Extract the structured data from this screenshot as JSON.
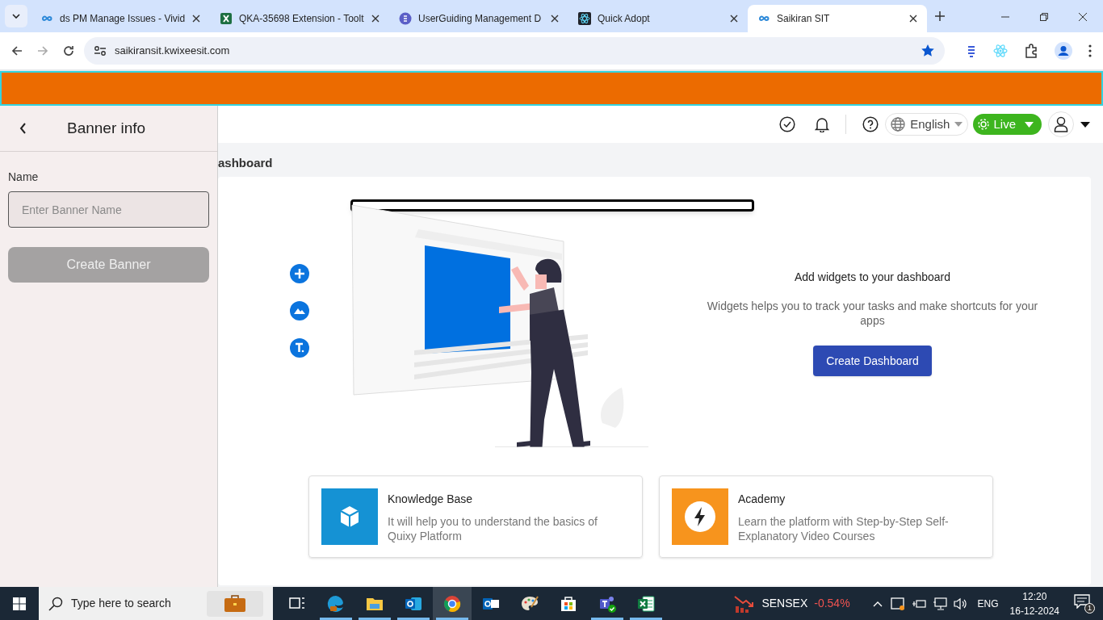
{
  "browser": {
    "tabs": [
      {
        "title": "ds PM Manage Issues - Vivid",
        "kind": "loop",
        "selected": false
      },
      {
        "title": "QKA-35698 Extension - Toolt",
        "kind": "excel",
        "selected": false
      },
      {
        "title": "UserGuiding Management D",
        "kind": "guide",
        "selected": false
      },
      {
        "title": "Quick Adopt",
        "kind": "atom",
        "selected": false
      },
      {
        "title": "Saikiran SIT",
        "kind": "loop",
        "selected": true
      }
    ],
    "url": "saikiransit.kwixeesit.com",
    "bookmarked": true
  },
  "panel": {
    "title": "Banner info",
    "name_label": "Name",
    "name_placeholder": "Enter Banner Name",
    "create_button": "Create Banner",
    "create_disabled": true
  },
  "header": {
    "language": "English",
    "mode": "Live"
  },
  "page_title": "ashboard",
  "dashboard": {
    "heading": "Add widgets to your dashboard",
    "description": "Widgets helps you to track your tasks and make shortcuts for your apps",
    "button": "Create Dashboard",
    "cards": [
      {
        "kind": "knowledge",
        "title": "Knowledge Base",
        "text": "It will help you to understand the basics of Quixy Platform",
        "color": "#1592d4"
      },
      {
        "kind": "academy",
        "title": "Academy",
        "text": "Learn the platform with Step-by-Step Self-Explanatory Video Courses",
        "color": "#f7941d"
      }
    ]
  },
  "taskbar": {
    "search_placeholder": "Type here to search",
    "apps": [
      {
        "kind": "taskview",
        "running": false,
        "selected": false
      },
      {
        "kind": "edge",
        "running": true,
        "selected": false
      },
      {
        "kind": "folder",
        "running": true,
        "selected": false
      },
      {
        "kind": "outlook",
        "running": true,
        "selected": false
      },
      {
        "kind": "chrome",
        "running": true,
        "selected": true
      },
      {
        "kind": "mail",
        "running": false,
        "selected": false
      },
      {
        "kind": "paint",
        "running": false,
        "selected": false
      },
      {
        "kind": "store",
        "running": false,
        "selected": false
      },
      {
        "kind": "teams",
        "running": true,
        "selected": false
      },
      {
        "kind": "excel",
        "running": true,
        "selected": false
      }
    ],
    "ticker": "SENSEX",
    "change": "-0.54%",
    "language": "ENG",
    "time": "12:20",
    "date": "16-12-2024",
    "notifications": "1"
  }
}
